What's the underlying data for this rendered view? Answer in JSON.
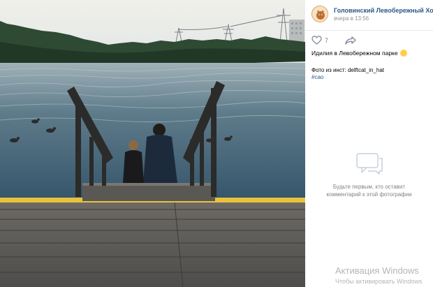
{
  "photo": {
    "alt": ""
  },
  "post": {
    "author": "Головинский Левобережный Ховр…",
    "time": "вчера в 13:56",
    "likes": "7",
    "caption": "Идилия в Левобережном парке",
    "credit": "Фото из инст: delftcat_in_hat",
    "hashtag": "#сао"
  },
  "comments": {
    "empty_line1": "Будьте первым, кто оставит",
    "empty_line2": "комментарий к этой фотографии"
  },
  "watermark": {
    "title": "Активация Windows",
    "subtitle": "Чтобы активировать Windows"
  },
  "icons": {
    "like": "heart-icon",
    "share": "share-arrow-icon",
    "comments": "speech-bubbles-icon",
    "emoji": "smiling-face-emoji-icon"
  },
  "colors": {
    "link": "#2a5885",
    "muted": "#828282",
    "edge_stripe": "#e9c23c"
  }
}
